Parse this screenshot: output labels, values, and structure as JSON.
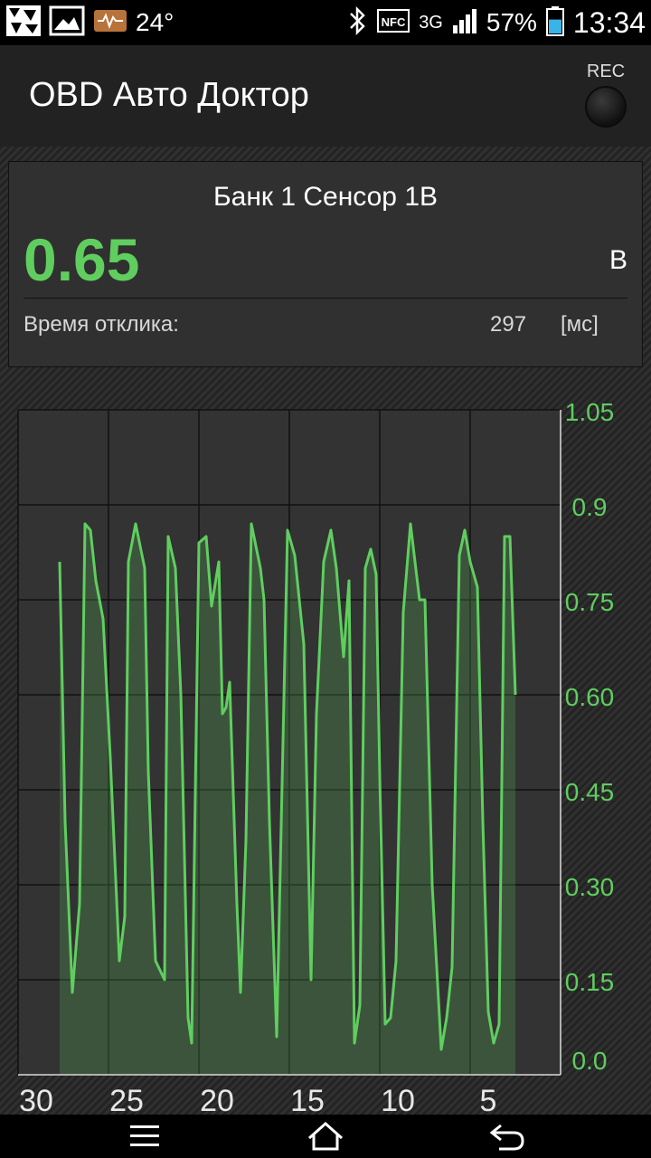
{
  "status_bar": {
    "temperature": "24°",
    "network": "3G",
    "nfc": "NFC",
    "battery": "57%",
    "battery_level": 0.57,
    "time": "13:34",
    "icons": [
      "gallery-app-icon",
      "image-icon",
      "obd-app-icon",
      "bluetooth-icon",
      "nfc-icon",
      "3g-icon",
      "signal-icon",
      "battery-icon"
    ]
  },
  "app_bar": {
    "title": "OBD Авто Доктор",
    "rec_label": "REC"
  },
  "sensor": {
    "name": "Банк 1 Сенсор 1В",
    "value": "0.65",
    "unit": "В",
    "response_label": "Время отклика:",
    "response_value": "297",
    "response_unit": "[мс]",
    "value_color": "#5fce5f"
  },
  "chart_data": {
    "type": "area",
    "x_ticks": [
      30,
      25,
      20,
      15,
      10,
      5
    ],
    "y_ticks": [
      "1.05",
      "0.9",
      "0.75",
      "0.60",
      "0.45",
      "0.30",
      "0.15",
      "0.0"
    ],
    "xlim": [
      30,
      0
    ],
    "ylim": [
      0,
      1.05
    ],
    "grid": true,
    "series_color": "#5fce5f",
    "x": [
      27.7,
      27.4,
      27.0,
      26.6,
      26.3,
      26.0,
      25.7,
      25.3,
      24.9,
      24.4,
      24.1,
      23.9,
      23.5,
      23.0,
      22.8,
      22.4,
      21.9,
      21.7,
      21.3,
      21.0,
      20.6,
      20.4,
      20.0,
      19.6,
      19.3,
      18.9,
      18.7,
      18.5,
      18.3,
      17.9,
      17.7,
      17.4,
      17.1,
      16.6,
      16.4,
      16.1,
      15.7,
      15.4,
      15.1,
      14.7,
      14.2,
      13.8,
      13.5,
      13.1,
      12.7,
      12.4,
      12.0,
      11.7,
      11.4,
      11.1,
      10.8,
      10.5,
      10.2,
      10.0,
      9.7,
      9.4,
      9.1,
      8.7,
      8.3,
      7.8,
      7.5,
      7.1,
      6.6,
      6.3,
      6.0,
      5.6,
      5.3,
      5.0,
      4.6,
      4.3,
      4.0,
      3.7,
      3.4,
      3.1,
      2.8,
      2.5,
      2.2,
      1.9,
      1.6,
      1.3,
      1.0,
      0.7,
      0.5,
      0.2
    ],
    "y": [
      0.81,
      0.4,
      0.13,
      0.27,
      0.87,
      0.86,
      0.78,
      0.72,
      0.5,
      0.18,
      0.25,
      0.81,
      0.87,
      0.8,
      0.48,
      0.18,
      0.15,
      0.85,
      0.8,
      0.6,
      0.09,
      0.05,
      0.84,
      0.85,
      0.74,
      0.81,
      0.57,
      0.58,
      0.62,
      0.27,
      0.13,
      0.37,
      0.87,
      0.8,
      0.75,
      0.4,
      0.06,
      0.46,
      0.86,
      0.82,
      0.68,
      0.15,
      0.57,
      0.81,
      0.86,
      0.8,
      0.66,
      0.78,
      0.05,
      0.11,
      0.8,
      0.83,
      0.79,
      0.47,
      0.08,
      0.09,
      0.18,
      0.73,
      0.87,
      0.75,
      0.75,
      0.3,
      0.04,
      0.09,
      0.17,
      0.82,
      0.86,
      0.81,
      0.77,
      0.4,
      0.1,
      0.05,
      0.08,
      0.85,
      0.85,
      0.6
    ]
  },
  "nav_bar": {
    "buttons": [
      "menu-icon",
      "home-icon",
      "back-icon"
    ]
  }
}
